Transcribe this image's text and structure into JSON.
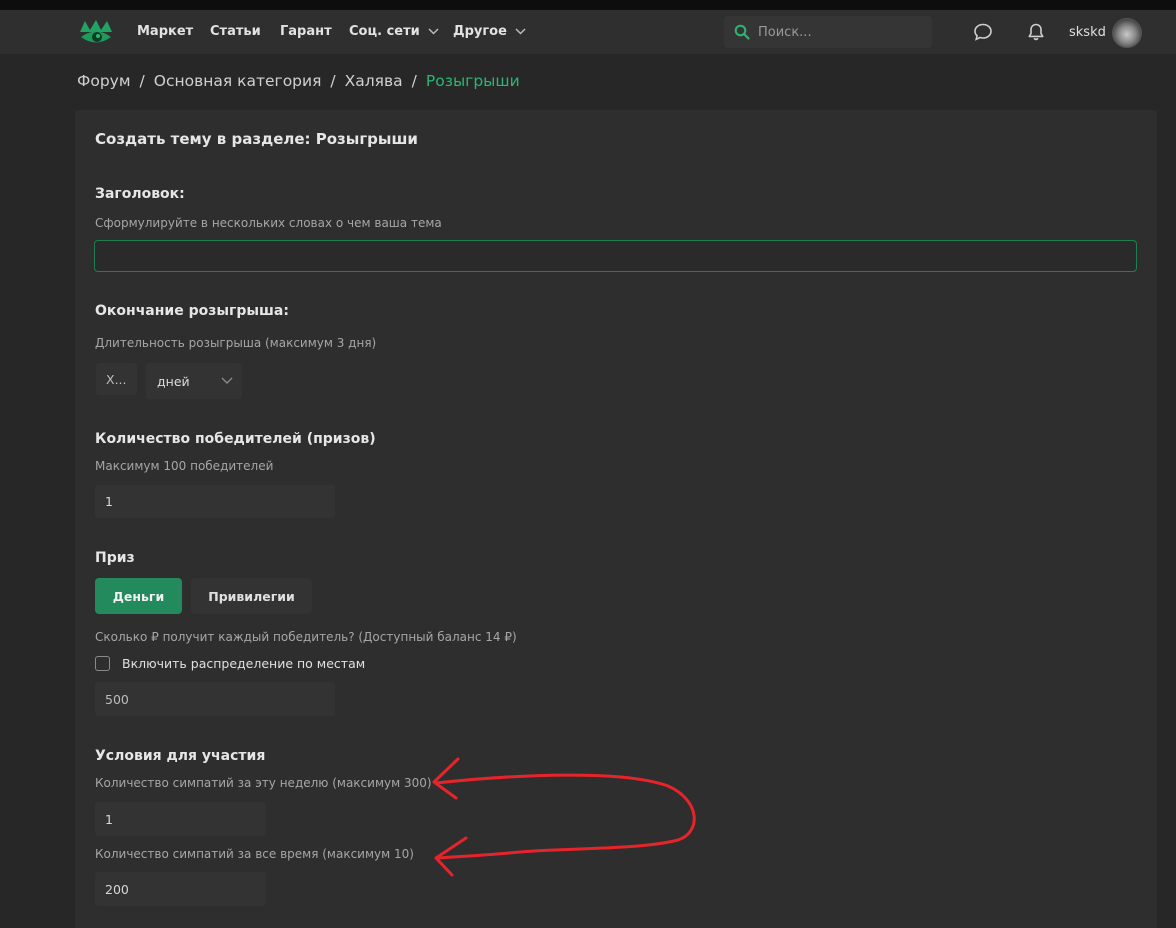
{
  "nav": {
    "items": [
      {
        "label": "Маркет"
      },
      {
        "label": "Статьи"
      },
      {
        "label": "Гарант"
      },
      {
        "label": "Соц. сети"
      },
      {
        "label": "Другое"
      }
    ],
    "search_placeholder": "Поиск...",
    "username": "skskd"
  },
  "breadcrumb": [
    "Форум",
    "Основная категория",
    "Халява",
    "Розыгрыши"
  ],
  "form": {
    "title": "Создать тему в разделе: Розыгрыши",
    "heading_label": "Заголовок:",
    "heading_hint": "Сформулируйте в нескольких словах о чем ваша тема",
    "heading_value": "",
    "end_label": "Окончание розыгрыша:",
    "end_hint": "Длительность розыгрыша (максимум 3 дня)",
    "duration_placeholder": "X...",
    "duration_unit": "дней",
    "winners_label": "Количество победителей (призов)",
    "winners_hint": "Максимум 100 победителей",
    "winners_value": "1",
    "prize_label": "Приз",
    "prize_money": "Деньги",
    "prize_privileges": "Привилегии",
    "amount_hint": "Сколько ₽ получит каждый победитель? (Доступный баланс 14 ₽)",
    "distribute_label": "Включить распределение по местам",
    "amount_value": "500",
    "conditions_label": "Условия для участия",
    "likes_week_hint": "Количество симпатий за эту неделю (максимум 300)",
    "likes_week_value": "1",
    "likes_all_hint": "Количество симпатий за все время (максимум 10)",
    "likes_all_value": "200"
  },
  "colors": {
    "accent": "#2bb673",
    "button_active": "#228a5c",
    "annotation": "#e5242b"
  }
}
